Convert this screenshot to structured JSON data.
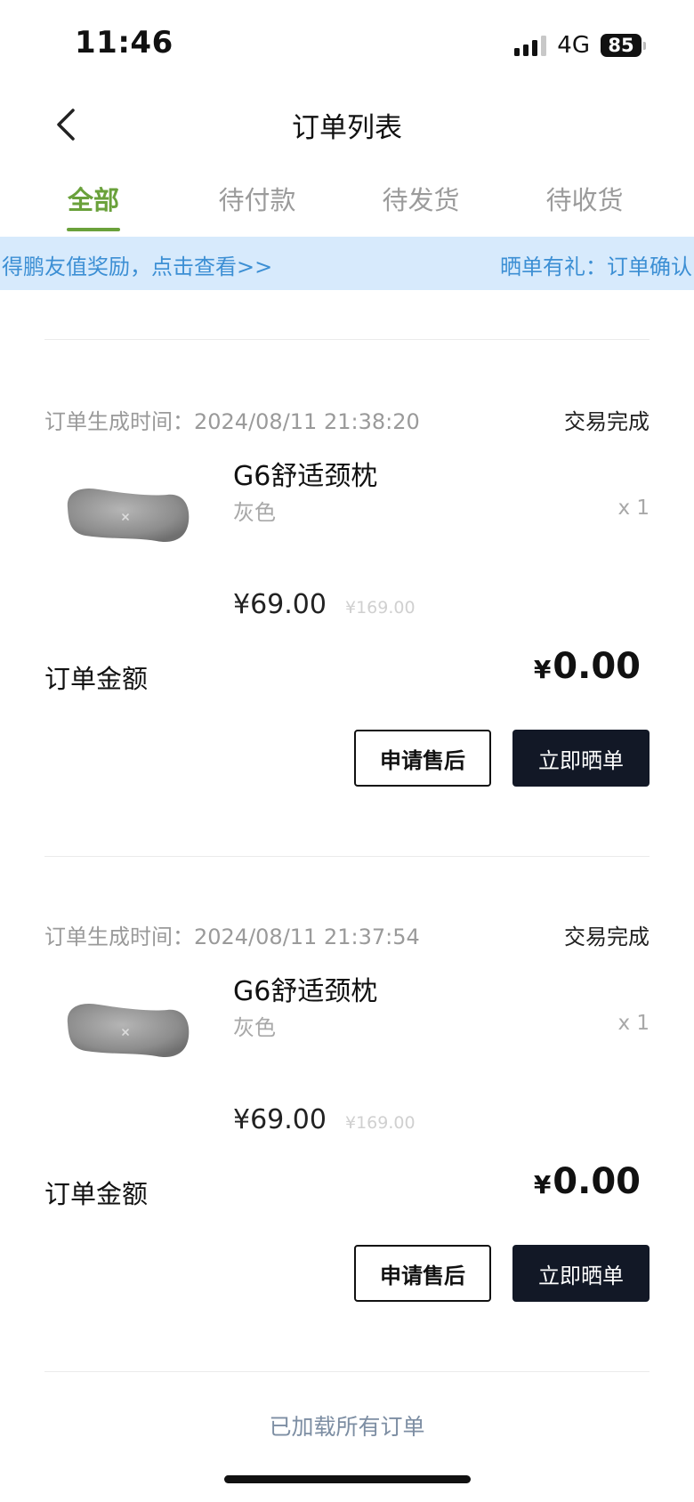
{
  "status_bar": {
    "time": "11:46",
    "network": "4G",
    "battery": "85"
  },
  "header": {
    "title": "订单列表"
  },
  "tabs": [
    {
      "label": "全部",
      "active": true
    },
    {
      "label": "待付款",
      "active": false
    },
    {
      "label": "待发货",
      "active": false
    },
    {
      "label": "待收货",
      "active": false
    }
  ],
  "banner": {
    "text_1": "得鹏友值奖励，点击查看>>",
    "text_2": "晒单有礼：订单确认"
  },
  "orders": [
    {
      "time_label": "订单生成时间：2024/08/11 21:38:20",
      "status": "交易完成",
      "product_name": "G6舒适颈枕",
      "variant": "灰色",
      "quantity": "x 1",
      "price": "¥69.00",
      "original_price": "¥169.00",
      "amount_label": "订单金额",
      "amount_currency": "¥",
      "amount_value": "0.00",
      "after_sale_label": "申请售后",
      "share_label": "立即晒单"
    },
    {
      "time_label": "订单生成时间：2024/08/11 21:37:54",
      "status": "交易完成",
      "product_name": "G6舒适颈枕",
      "variant": "灰色",
      "quantity": "x 1",
      "price": "¥69.00",
      "original_price": "¥169.00",
      "amount_label": "订单金额",
      "amount_currency": "¥",
      "amount_value": "0.00",
      "after_sale_label": "申请售后",
      "share_label": "立即晒单"
    }
  ],
  "footer": {
    "text": "已加载所有订单"
  },
  "colors": {
    "accent": "#6aa13b",
    "banner_bg": "#d7eafc",
    "banner_text": "#3c8fd4",
    "button_dark": "#121826"
  },
  "icons": {
    "back": "chevron-left-icon"
  }
}
